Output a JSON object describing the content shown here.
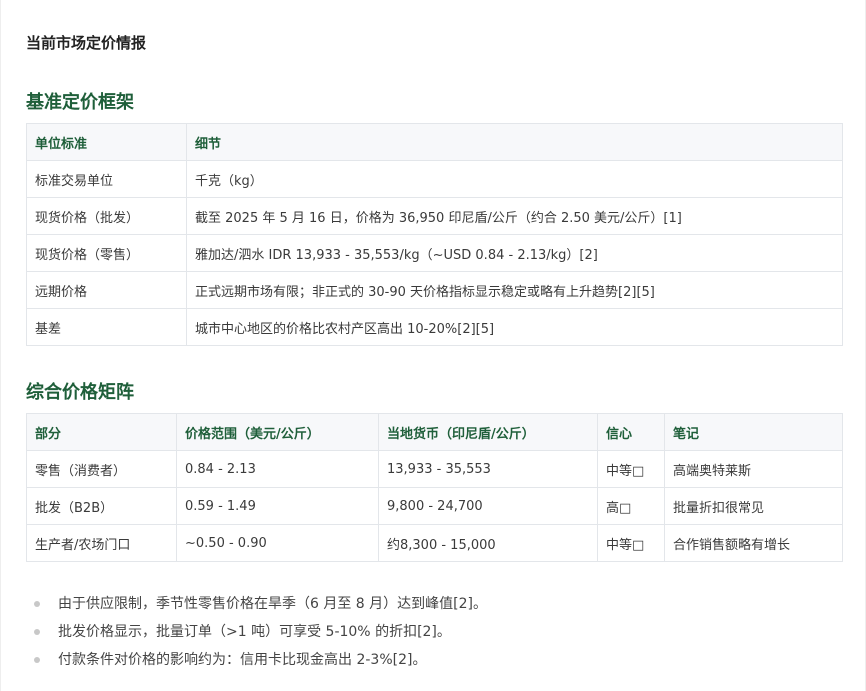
{
  "header": {
    "title": "当前市场定价情报"
  },
  "section1": {
    "title": "基准定价框架",
    "columns": [
      "单位标准",
      "细节"
    ],
    "rows": [
      [
        "标准交易单位",
        "千克（kg）"
      ],
      [
        "现货价格（批发）",
        "截至 2025 年 5 月 16 日，价格为 36,950 印尼盾/公斤（约合 2.50 美元/公斤）[1]"
      ],
      [
        "现货价格（零售）",
        "雅加达/泗水 IDR 13,933 - 35,553/kg（~USD 0.84 - 2.13/kg）[2]"
      ],
      [
        "远期价格",
        "正式远期市场有限；非正式的 30-90 天价格指标显示稳定或略有上升趋势[2][5]"
      ],
      [
        "基差",
        "城市中心地区的价格比农村产区高出 10-20%[2][5]"
      ]
    ]
  },
  "section2": {
    "title": "综合价格矩阵",
    "columns": [
      "部分",
      "价格范围（美元/公斤）",
      "当地货币（印尼盾/公斤）",
      "信心",
      "笔记"
    ],
    "rows": [
      [
        "零售（消费者）",
        "0.84 - 2.13",
        "13,933 - 35,553",
        "中等□",
        "高端奥特莱斯"
      ],
      [
        "批发（B2B）",
        "0.59 - 1.49",
        "9,800 - 24,700",
        "高□",
        "批量折扣很常见"
      ],
      [
        "生产者/农场门口",
        "~0.50 - 0.90",
        "约8,300 - 15,000",
        "中等□",
        "合作销售额略有增长"
      ]
    ]
  },
  "bullets": [
    "由于供应限制，季节性零售价格在旱季（6 月至 8 月）达到峰值[2]。",
    "批发价格显示，批量订单（>1 吨）可享受 5-10% 的折扣[2]。",
    "付款条件对价格的影响约为：信用卡比现金高出 2-3%[2]。"
  ]
}
